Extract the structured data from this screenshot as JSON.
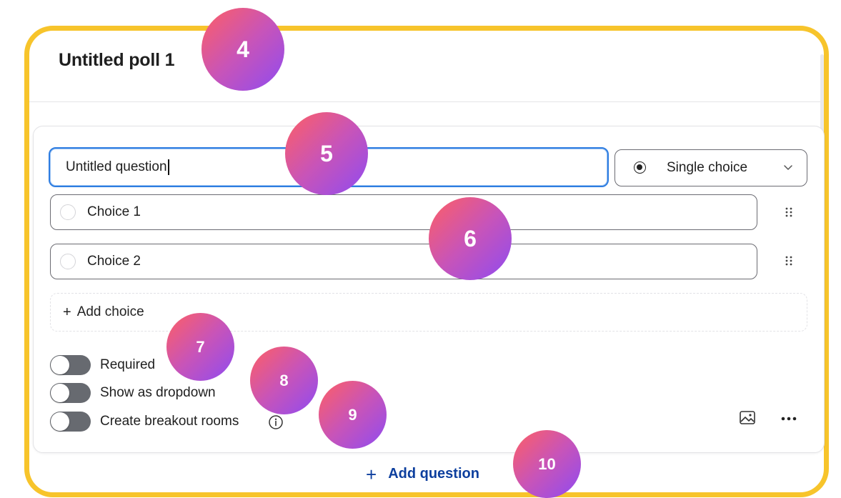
{
  "poll": {
    "title": "Untitled poll 1"
  },
  "question": {
    "value": "Untitled question",
    "type_label": "Single choice",
    "choices": [
      {
        "label": "Choice 1"
      },
      {
        "label": "Choice 2"
      }
    ],
    "add_choice_label": "Add choice",
    "options": [
      {
        "label": "Required",
        "enabled": false
      },
      {
        "label": "Show as dropdown",
        "enabled": false
      },
      {
        "label": "Create breakout rooms",
        "enabled": false
      }
    ]
  },
  "footer": {
    "add_question_label": "Add question"
  },
  "badges": [
    "4",
    "5",
    "6",
    "7",
    "8",
    "9",
    "10"
  ],
  "colors": {
    "highlight_border": "#f7c42b",
    "focus_border": "#2e7de1",
    "add_question_text": "#0d3f9e",
    "toggle_off": "#676a70",
    "badge_gradient_start": "#ff5f63",
    "badge_gradient_end": "#8f4bf1"
  },
  "icons": {
    "type_select": "radio-selected-icon",
    "dropdown": "chevron-down-icon",
    "reorder": "drag-handle-icon",
    "info": "info-icon",
    "image": "image-icon",
    "more": "more-horizontal-icon",
    "add": "plus-icon"
  }
}
